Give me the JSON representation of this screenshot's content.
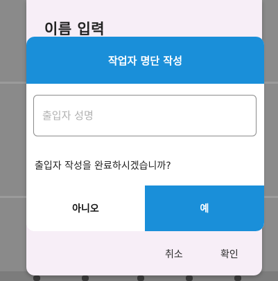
{
  "outer_dialog": {
    "title": "이름 입력",
    "cancel_label": "취소",
    "confirm_label": "확인"
  },
  "inner_dialog": {
    "title": "작업자 명단 작성",
    "name_input": {
      "value": "",
      "placeholder": "출입자 성명"
    },
    "message": "출입자 작성을 완료하시겠습니까?",
    "no_label": "아니오",
    "yes_label": "예"
  },
  "colors": {
    "accent": "#1a8fd9",
    "outer_dialog_bg": "#f7eef7",
    "scrim": "#8a8a8a"
  }
}
